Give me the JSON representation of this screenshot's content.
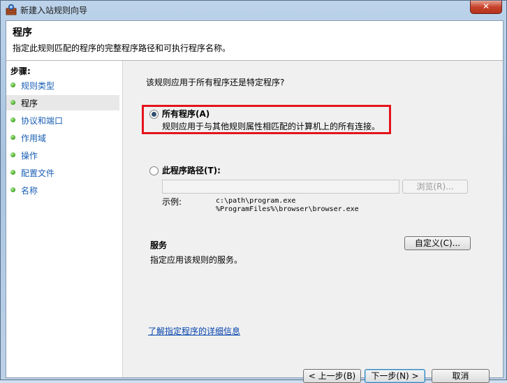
{
  "window": {
    "title": "新建入站规则向导",
    "close_label": "✕"
  },
  "header": {
    "title": "程序",
    "description": "指定此规则匹配的程序的完整程序路径和可执行程序名称。"
  },
  "steps": {
    "title": "步骤:",
    "items": [
      {
        "label": "规则类型"
      },
      {
        "label": "程序"
      },
      {
        "label": "协议和端口"
      },
      {
        "label": "作用域"
      },
      {
        "label": "操作"
      },
      {
        "label": "配置文件"
      },
      {
        "label": "名称"
      }
    ]
  },
  "main": {
    "question": "该规则应用于所有程序还是特定程序?",
    "all_programs": {
      "label": "所有程序(A)",
      "description": "规则应用于与其他规则属性相匹配的计算机上的所有连接。",
      "selected": true
    },
    "this_program": {
      "label": "此程序路径(T):",
      "selected": false,
      "path_value": "",
      "browse_label": "浏览(R)..."
    },
    "example": {
      "label": "示例:",
      "line1": "c:\\path\\program.exe",
      "line2": "%ProgramFiles%\\browser\\browser.exe"
    },
    "services": {
      "title": "服务",
      "description": "指定应用该规则的服务。",
      "customize_label": "自定义(C)..."
    },
    "learn_more": "了解指定程序的详细信息"
  },
  "footer": {
    "back_label": "< 上一步(B)",
    "next_label": "下一步(N) >",
    "cancel_label": "取消"
  },
  "colors": {
    "highlight_border": "#e5131b",
    "link": "#0645ad",
    "step_dot": "#3aa01d"
  },
  "icons": {
    "app": "firewall-icon",
    "step": "green-bullet-icon"
  }
}
